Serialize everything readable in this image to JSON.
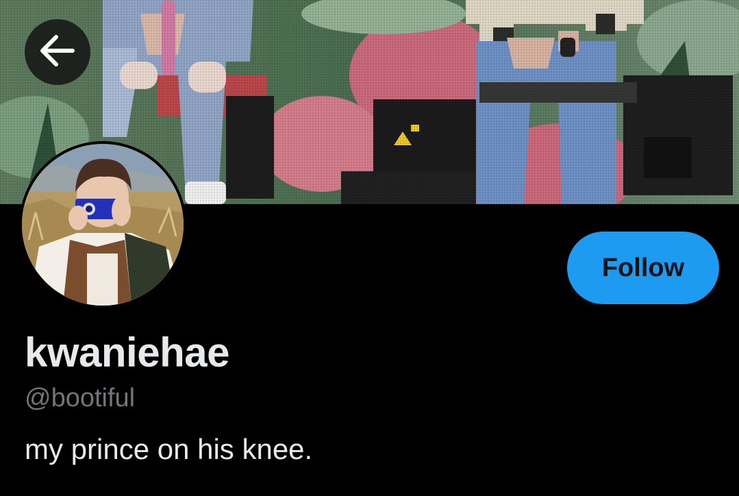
{
  "profile": {
    "display_name": "kwaniehae",
    "handle": "@bootiful",
    "bio": "my prince on his knee."
  },
  "actions": {
    "follow_label": "Follow",
    "back_icon": "arrow-left-icon"
  },
  "colors": {
    "follow_button": "#1d9bf0",
    "handle_text": "#71767b",
    "background": "#000000"
  }
}
